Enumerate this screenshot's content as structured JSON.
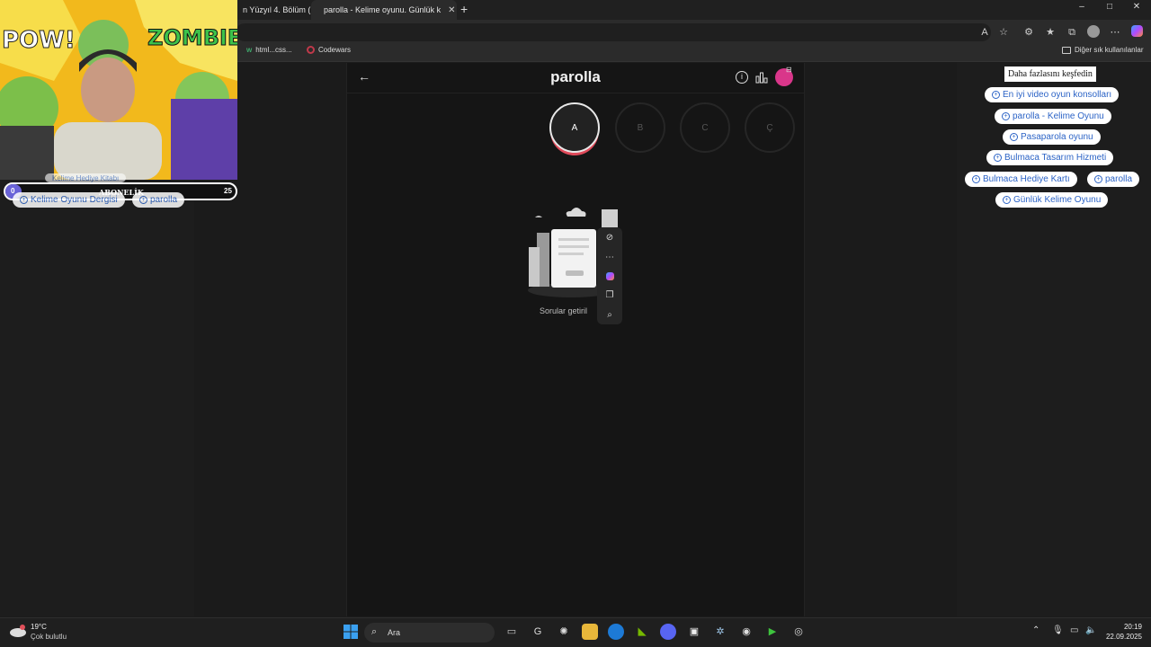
{
  "browser": {
    "tabs": [
      {
        "label": "n Yüzyıl 4. Bölüm (",
        "active": false
      },
      {
        "label": "parolla - Kelime oyunu. Günlük k",
        "active": true
      }
    ],
    "new_tab": "+",
    "window_controls": [
      "–",
      "□",
      "✕"
    ],
    "bookmarks": [
      {
        "label": "html...css..."
      },
      {
        "label": "Codewars"
      }
    ],
    "other_bookmarks": "Diğer sık kullanılanlar"
  },
  "app": {
    "brand": "parolla",
    "letters": [
      {
        "label": "A",
        "active": true
      },
      {
        "label": "B",
        "active": false
      },
      {
        "label": "C",
        "active": false
      },
      {
        "label": "Ç",
        "active": false
      }
    ],
    "loading_text": "Sorular getiril",
    "accent": "#e04a5a"
  },
  "sidebar": {
    "title": "Daha fazlasını keşfedin",
    "chips": [
      "En iyi video oyun konsolları",
      "parolla - Kelime Oyunu",
      "Pasaparola oyunu",
      "Bulmaca Tasarım Hizmeti",
      "Bulmaca Hediye Kartı",
      "parolla",
      "Günlük Kelime Oyunu"
    ]
  },
  "overlay": {
    "chips": [
      "Kelime Oyunu Dergisi",
      "parolla"
    ],
    "hidden_chip": "Kelime Hediye Kitabı",
    "sub_label": "ABONELİK",
    "sub_current": "0",
    "sub_goal": "25",
    "comic_left": "POW!",
    "comic_right": "ZOMBIE!"
  },
  "taskbar": {
    "weather_temp": "19°C",
    "weather_desc": "Çok bulutlu",
    "search_placeholder": "Ara",
    "time": "20:19",
    "date": "22.09.2025"
  }
}
